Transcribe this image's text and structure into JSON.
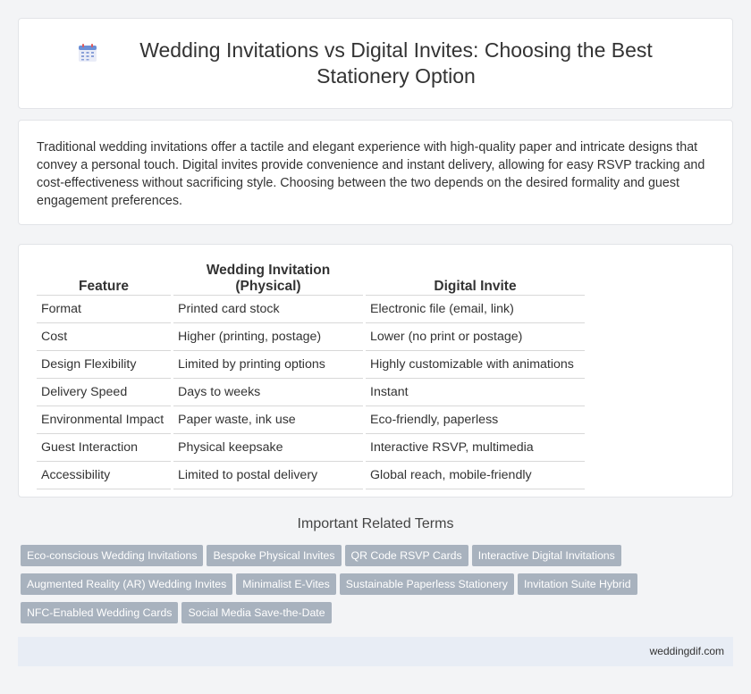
{
  "header": {
    "title": "Wedding Invitations vs Digital Invites: Choosing the Best Stationery Option"
  },
  "intro": {
    "text": "Traditional wedding invitations offer a tactile and elegant experience with high-quality paper and intricate designs that convey a personal touch. Digital invites provide convenience and instant delivery, allowing for easy RSVP tracking and cost-effectiveness without sacrificing style. Choosing between the two depends on the desired formality and guest engagement preferences."
  },
  "table": {
    "headers": [
      "Feature",
      "Wedding Invitation (Physical)",
      "Digital Invite"
    ],
    "rows": [
      [
        "Format",
        "Printed card stock",
        "Electronic file (email, link)"
      ],
      [
        "Cost",
        "Higher (printing, postage)",
        "Lower (no print or postage)"
      ],
      [
        "Design Flexibility",
        "Limited by printing options",
        "Highly customizable with animations"
      ],
      [
        "Delivery Speed",
        "Days to weeks",
        "Instant"
      ],
      [
        "Environmental Impact",
        "Paper waste, ink use",
        "Eco-friendly, paperless"
      ],
      [
        "Guest Interaction",
        "Physical keepsake",
        "Interactive RSVP, multimedia"
      ],
      [
        "Accessibility",
        "Limited to postal delivery",
        "Global reach, mobile-friendly"
      ]
    ]
  },
  "related": {
    "title": "Important Related Terms",
    "tags": [
      "Eco-conscious Wedding Invitations",
      "Bespoke Physical Invites",
      "QR Code RSVP Cards",
      "Interactive Digital Invitations",
      "Augmented Reality (AR) Wedding Invites",
      "Minimalist E-Vites",
      "Sustainable Paperless Stationery",
      "Invitation Suite Hybrid",
      "NFC-Enabled Wedding Cards",
      "Social Media Save-the-Date"
    ]
  },
  "footer": {
    "site": "weddingdif.com"
  },
  "icons": {
    "header_icon": "calendar-icon"
  },
  "colors": {
    "tag_bg": "#a8b2be",
    "footer_bg": "#e8edf5",
    "page_bg": "#f3f4f6"
  }
}
